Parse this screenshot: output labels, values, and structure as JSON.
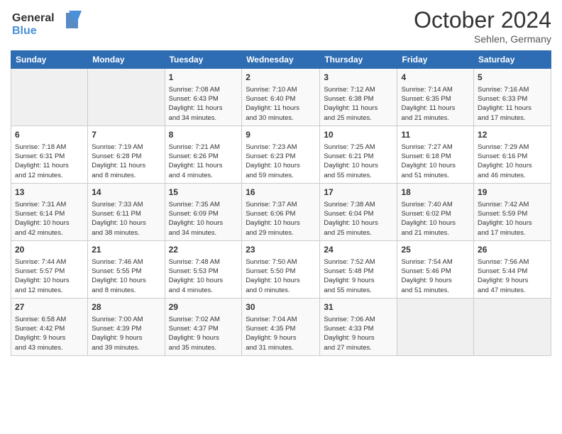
{
  "header": {
    "logo_line1": "General",
    "logo_line2": "Blue",
    "month": "October 2024",
    "location": "Sehlen, Germany"
  },
  "weekdays": [
    "Sunday",
    "Monday",
    "Tuesday",
    "Wednesday",
    "Thursday",
    "Friday",
    "Saturday"
  ],
  "weeks": [
    [
      {
        "day": "",
        "info": ""
      },
      {
        "day": "",
        "info": ""
      },
      {
        "day": "1",
        "info": "Sunrise: 7:08 AM\nSunset: 6:43 PM\nDaylight: 11 hours\nand 34 minutes."
      },
      {
        "day": "2",
        "info": "Sunrise: 7:10 AM\nSunset: 6:40 PM\nDaylight: 11 hours\nand 30 minutes."
      },
      {
        "day": "3",
        "info": "Sunrise: 7:12 AM\nSunset: 6:38 PM\nDaylight: 11 hours\nand 25 minutes."
      },
      {
        "day": "4",
        "info": "Sunrise: 7:14 AM\nSunset: 6:35 PM\nDaylight: 11 hours\nand 21 minutes."
      },
      {
        "day": "5",
        "info": "Sunrise: 7:16 AM\nSunset: 6:33 PM\nDaylight: 11 hours\nand 17 minutes."
      }
    ],
    [
      {
        "day": "6",
        "info": "Sunrise: 7:18 AM\nSunset: 6:31 PM\nDaylight: 11 hours\nand 12 minutes."
      },
      {
        "day": "7",
        "info": "Sunrise: 7:19 AM\nSunset: 6:28 PM\nDaylight: 11 hours\nand 8 minutes."
      },
      {
        "day": "8",
        "info": "Sunrise: 7:21 AM\nSunset: 6:26 PM\nDaylight: 11 hours\nand 4 minutes."
      },
      {
        "day": "9",
        "info": "Sunrise: 7:23 AM\nSunset: 6:23 PM\nDaylight: 10 hours\nand 59 minutes."
      },
      {
        "day": "10",
        "info": "Sunrise: 7:25 AM\nSunset: 6:21 PM\nDaylight: 10 hours\nand 55 minutes."
      },
      {
        "day": "11",
        "info": "Sunrise: 7:27 AM\nSunset: 6:18 PM\nDaylight: 10 hours\nand 51 minutes."
      },
      {
        "day": "12",
        "info": "Sunrise: 7:29 AM\nSunset: 6:16 PM\nDaylight: 10 hours\nand 46 minutes."
      }
    ],
    [
      {
        "day": "13",
        "info": "Sunrise: 7:31 AM\nSunset: 6:14 PM\nDaylight: 10 hours\nand 42 minutes."
      },
      {
        "day": "14",
        "info": "Sunrise: 7:33 AM\nSunset: 6:11 PM\nDaylight: 10 hours\nand 38 minutes."
      },
      {
        "day": "15",
        "info": "Sunrise: 7:35 AM\nSunset: 6:09 PM\nDaylight: 10 hours\nand 34 minutes."
      },
      {
        "day": "16",
        "info": "Sunrise: 7:37 AM\nSunset: 6:06 PM\nDaylight: 10 hours\nand 29 minutes."
      },
      {
        "day": "17",
        "info": "Sunrise: 7:38 AM\nSunset: 6:04 PM\nDaylight: 10 hours\nand 25 minutes."
      },
      {
        "day": "18",
        "info": "Sunrise: 7:40 AM\nSunset: 6:02 PM\nDaylight: 10 hours\nand 21 minutes."
      },
      {
        "day": "19",
        "info": "Sunrise: 7:42 AM\nSunset: 5:59 PM\nDaylight: 10 hours\nand 17 minutes."
      }
    ],
    [
      {
        "day": "20",
        "info": "Sunrise: 7:44 AM\nSunset: 5:57 PM\nDaylight: 10 hours\nand 12 minutes."
      },
      {
        "day": "21",
        "info": "Sunrise: 7:46 AM\nSunset: 5:55 PM\nDaylight: 10 hours\nand 8 minutes."
      },
      {
        "day": "22",
        "info": "Sunrise: 7:48 AM\nSunset: 5:53 PM\nDaylight: 10 hours\nand 4 minutes."
      },
      {
        "day": "23",
        "info": "Sunrise: 7:50 AM\nSunset: 5:50 PM\nDaylight: 10 hours\nand 0 minutes."
      },
      {
        "day": "24",
        "info": "Sunrise: 7:52 AM\nSunset: 5:48 PM\nDaylight: 9 hours\nand 55 minutes."
      },
      {
        "day": "25",
        "info": "Sunrise: 7:54 AM\nSunset: 5:46 PM\nDaylight: 9 hours\nand 51 minutes."
      },
      {
        "day": "26",
        "info": "Sunrise: 7:56 AM\nSunset: 5:44 PM\nDaylight: 9 hours\nand 47 minutes."
      }
    ],
    [
      {
        "day": "27",
        "info": "Sunrise: 6:58 AM\nSunset: 4:42 PM\nDaylight: 9 hours\nand 43 minutes."
      },
      {
        "day": "28",
        "info": "Sunrise: 7:00 AM\nSunset: 4:39 PM\nDaylight: 9 hours\nand 39 minutes."
      },
      {
        "day": "29",
        "info": "Sunrise: 7:02 AM\nSunset: 4:37 PM\nDaylight: 9 hours\nand 35 minutes."
      },
      {
        "day": "30",
        "info": "Sunrise: 7:04 AM\nSunset: 4:35 PM\nDaylight: 9 hours\nand 31 minutes."
      },
      {
        "day": "31",
        "info": "Sunrise: 7:06 AM\nSunset: 4:33 PM\nDaylight: 9 hours\nand 27 minutes."
      },
      {
        "day": "",
        "info": ""
      },
      {
        "day": "",
        "info": ""
      }
    ]
  ]
}
